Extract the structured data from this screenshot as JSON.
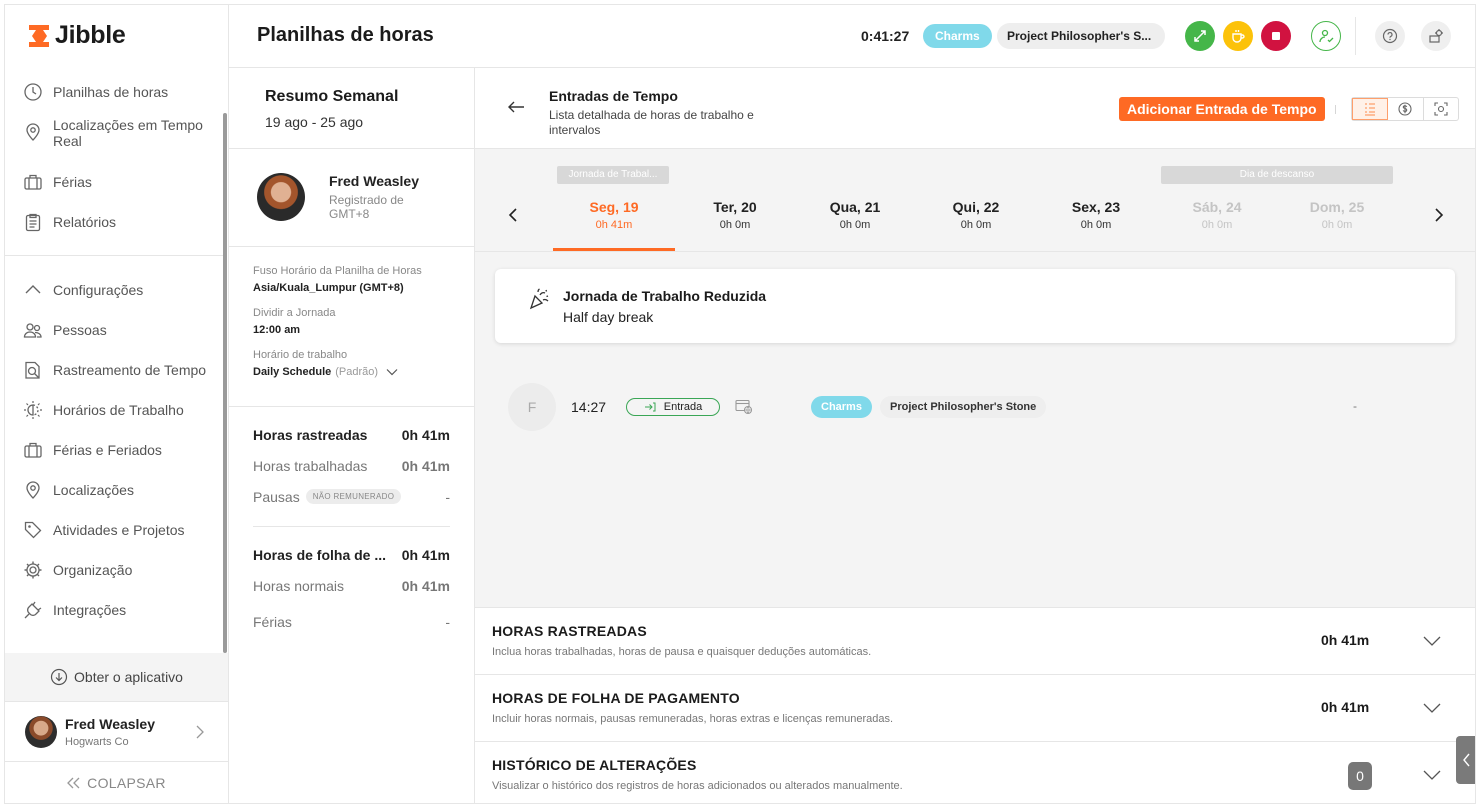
{
  "brand": {
    "name": "Jibble",
    "accent": "#fe6a24"
  },
  "sidebar": {
    "items": [
      {
        "label": "Planilhas de horas",
        "icon": "clock-icon"
      },
      {
        "label": "Localizações em Tempo Real",
        "icon": "location-pin-icon"
      },
      {
        "label": "Férias",
        "icon": "suitcase-icon"
      },
      {
        "label": "Relatórios",
        "icon": "clipboard-icon"
      }
    ],
    "settings_items": [
      {
        "label": "Configurações",
        "icon": "chevron-up-icon"
      },
      {
        "label": "Pessoas",
        "icon": "people-icon"
      },
      {
        "label": "Rastreamento de Tempo",
        "icon": "time-tracking-icon"
      },
      {
        "label": "Horários de Trabalho",
        "icon": "sun-schedule-icon"
      },
      {
        "label": "Férias e Feriados",
        "icon": "suitcase-icon"
      },
      {
        "label": "Localizações",
        "icon": "location-pin-icon"
      },
      {
        "label": "Atividades e Projetos",
        "icon": "tag-icon"
      },
      {
        "label": "Organização",
        "icon": "gear-icon"
      },
      {
        "label": "Integrações",
        "icon": "plug-icon"
      }
    ],
    "get_app": "Obter o aplicativo",
    "user_name": "Fred Weasley",
    "user_org": "Hogwarts Co",
    "collapse": "COLAPSAR"
  },
  "header": {
    "title": "Planilhas de horas",
    "timer": "0:41:27",
    "activity": "Charms",
    "project": "Project Philosopher's S..."
  },
  "summary": {
    "title": "Resumo Semanal",
    "range": "19 ago - 25 ago",
    "user_name": "Fred Weasley",
    "user_reg": "Registrado de GMT+8",
    "tz_label": "Fuso Horário da Planilha de Horas",
    "tz_value": "Asia/Kuala_Lumpur (GMT+8)",
    "split_label": "Dividir a Jornada",
    "split_value": "12:00 am",
    "schedule_label": "Horário de trabalho",
    "schedule_value": "Daily Schedule",
    "schedule_default": "(Padrão)",
    "tracked_label": "Horas rastreadas",
    "tracked_value": "0h 41m",
    "worked_label": "Horas trabalhadas",
    "worked_value": "0h 41m",
    "breaks_label": "Pausas",
    "breaks_badge": "NÃO REMUNERADO",
    "breaks_value": "-",
    "payroll_label": "Horas de folha de ...",
    "payroll_value": "0h 41m",
    "normal_label": "Horas normais",
    "normal_value": "0h 41m",
    "leave_label": "Férias",
    "leave_value": "-"
  },
  "main": {
    "title": "Entradas de Tempo",
    "subtitle": "Lista detalhada de horas de trabalho e intervalos",
    "add_button": "Adicionar Entrada de Tempo",
    "tag_short_day": "Jornada de Trabal...",
    "tag_rest_day": "Dia de descanso",
    "days": [
      {
        "name": "Seg, 19",
        "hours": "0h 41m"
      },
      {
        "name": "Ter, 20",
        "hours": "0h 0m"
      },
      {
        "name": "Qua, 21",
        "hours": "0h 0m"
      },
      {
        "name": "Qui, 22",
        "hours": "0h 0m"
      },
      {
        "name": "Sex, 23",
        "hours": "0h 0m"
      },
      {
        "name": "Sáb, 24",
        "hours": "0h 0m"
      },
      {
        "name": "Dom, 25",
        "hours": "0h 0m"
      }
    ],
    "notice_title": "Jornada de Trabalho Reduzida",
    "notice_text": "Half day break",
    "entry": {
      "avatar": "F",
      "time": "14:27",
      "type": "Entrada",
      "activity": "Charms",
      "project": "Project Philosopher's Stone",
      "note": "-"
    },
    "sections": [
      {
        "title": "HORAS RASTREADAS",
        "desc": "Inclua horas trabalhadas, horas de pausa e quaisquer deduções automáticas.",
        "value": "0h 41m"
      },
      {
        "title": "HORAS DE FOLHA DE PAGAMENTO",
        "desc": "Incluir horas normais, pausas remuneradas, horas extras e licenças remuneradas.",
        "value": "0h 41m"
      },
      {
        "title": "HISTÓRICO DE ALTERAÇÕES",
        "desc": "Visualizar o histórico dos registros de horas adicionados ou alterados manualmente.",
        "count": "0"
      }
    ]
  }
}
